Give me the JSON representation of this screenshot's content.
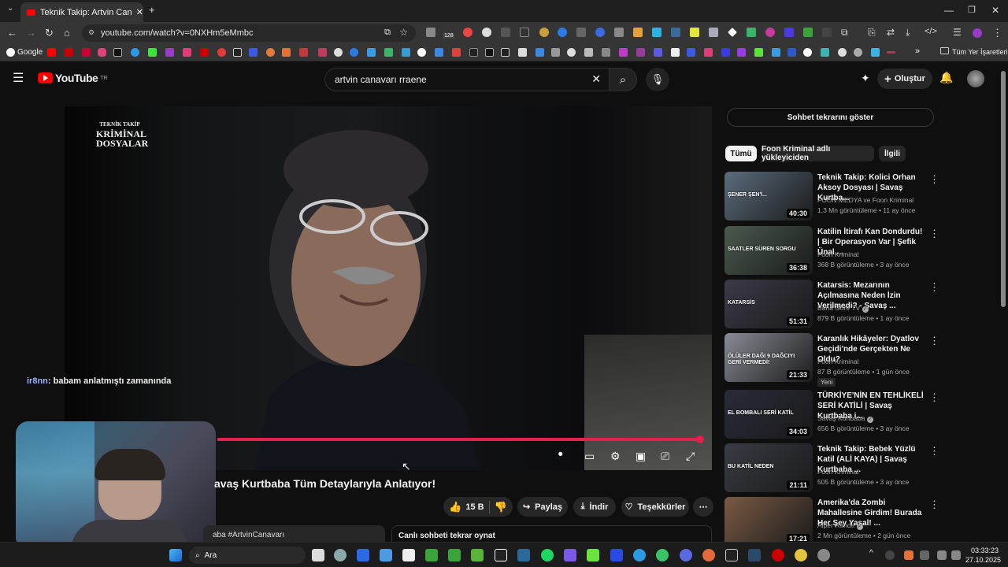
{
  "browser": {
    "tab_title": "Teknik Takip: Artvin Canavan | S",
    "url": "youtube.com/watch?v=0NXHm5eMmbc",
    "bookmark_first": "Google",
    "bookmark_all": "Tüm Yer İşaretleri",
    "ext_badge": "128"
  },
  "youtube": {
    "logo_text": "YouTube",
    "logo_sup": "TR",
    "search_query": "artvin canavarı rraene",
    "create_label": "Oluştur"
  },
  "player": {
    "overlay_line1": "TEKNİK TAKİP",
    "overlay_line2": "KRİMİNAL",
    "overlay_line3": "DOSYALAR"
  },
  "stream": {
    "chat_user": "ir8nn",
    "chat_text": ": babam anlatmıştı zamanında"
  },
  "video": {
    "title_visible": "avaş Kurtbaba Tüm Detaylarıyla Anlatıyor!",
    "likes": "15 B",
    "share_label": "Paylaş",
    "download_label": "İndir",
    "thanks_label": "Teşekkürler",
    "desc_snippet": "aba #ArtvinCanavarı",
    "chat_replay_label": "Canlı sohbeti tekrar oynat"
  },
  "sidebar": {
    "chat_toggle": "Sohbet tekrarını göster",
    "chips": [
      "Tümü",
      "Foon Kriminal adlı yükleyiciden",
      "İlgili"
    ],
    "recommendations": [
      {
        "title": "Teknik Takip: Kolici Orhan Aksoy Dosyası | Savaş Kurtba...",
        "channel": "FOON MEDYA ve Foon Kriminal",
        "meta": "1,3 Mn görüntüleme • 11 ay önce",
        "duration": "40:30",
        "verified": false,
        "is_new": false,
        "thumb_text": "ŞENER ŞEN'İ...",
        "thumb_color": "#5a6c7c"
      },
      {
        "title": "Katilin İtirafı Kan Dondurdu! | Bir Operasyon Var | Şefik Ünal ...",
        "channel": "Foon Kriminal",
        "meta": "368 B görüntüleme • 3 ay önce",
        "duration": "36:38",
        "verified": false,
        "is_new": false,
        "thumb_text": "SAATLER SÜREN SORGU",
        "thumb_color": "#4a5a4e"
      },
      {
        "title": "Katarsis: Mezarının Açılmasına Neden İzin Verilmedi? - Savaş ...",
        "channel": "Bana Göre TV",
        "meta": "879 B görüntüleme • 1 ay önce",
        "duration": "51:31",
        "verified": true,
        "is_new": false,
        "thumb_text": "KATARSİS",
        "thumb_color": "#3c3a48"
      },
      {
        "title": "Karanlık Hikâyeler: Dyatlov Geçidi'nde Gerçekten Ne Oldu?",
        "channel": "Foon Kriminal",
        "meta": "87 B görüntüleme • 1 gün önce",
        "duration": "21:33",
        "verified": false,
        "is_new": true,
        "new_label": "Yeni",
        "thumb_text": "ÖLÜLER DAĞI 9 DAĞCIYI GERİ VERMEDİ!",
        "thumb_color": "#8a8c96"
      },
      {
        "title": "TÜRKİYE'NİN EN TEHLİKELİ SERİ KATİLİ | Savaş Kurtbaba i...",
        "channel": "Savaş Kurtbaba",
        "meta": "656 B görüntüleme • 3 ay önce",
        "duration": "34:03",
        "verified": true,
        "is_new": false,
        "thumb_text": "EL BOMBALI SERİ KATİL",
        "thumb_color": "#2a2a3a"
      },
      {
        "title": "Teknik Takip: Bebek Yüzlü Katil (ALİ KAYA) | Savaş Kurtbaba ...",
        "channel": "Foon Kriminal",
        "meta": "505 B görüntüleme • 3 ay önce",
        "duration": "21:11",
        "verified": false,
        "is_new": false,
        "thumb_text": "BU KATİL NEDEN",
        "thumb_color": "#3a3c44"
      },
      {
        "title": "Amerika'da Zombi Mahallesine Girdim! Burada Her Şey Yasal! ...",
        "channel": "Alper Rende",
        "meta": "2 Mn görüntüleme • 2 gün önce",
        "duration": "17:21",
        "verified": true,
        "is_new": false,
        "thumb_text": "",
        "thumb_color": "#7a5a44"
      }
    ]
  },
  "taskbar": {
    "search_label": "Ara",
    "time": "03:33:23",
    "date": "27.10.2025"
  },
  "colors": {
    "accent": "#e3224a",
    "bg": "#0f0f0f",
    "chip": "#272727"
  }
}
